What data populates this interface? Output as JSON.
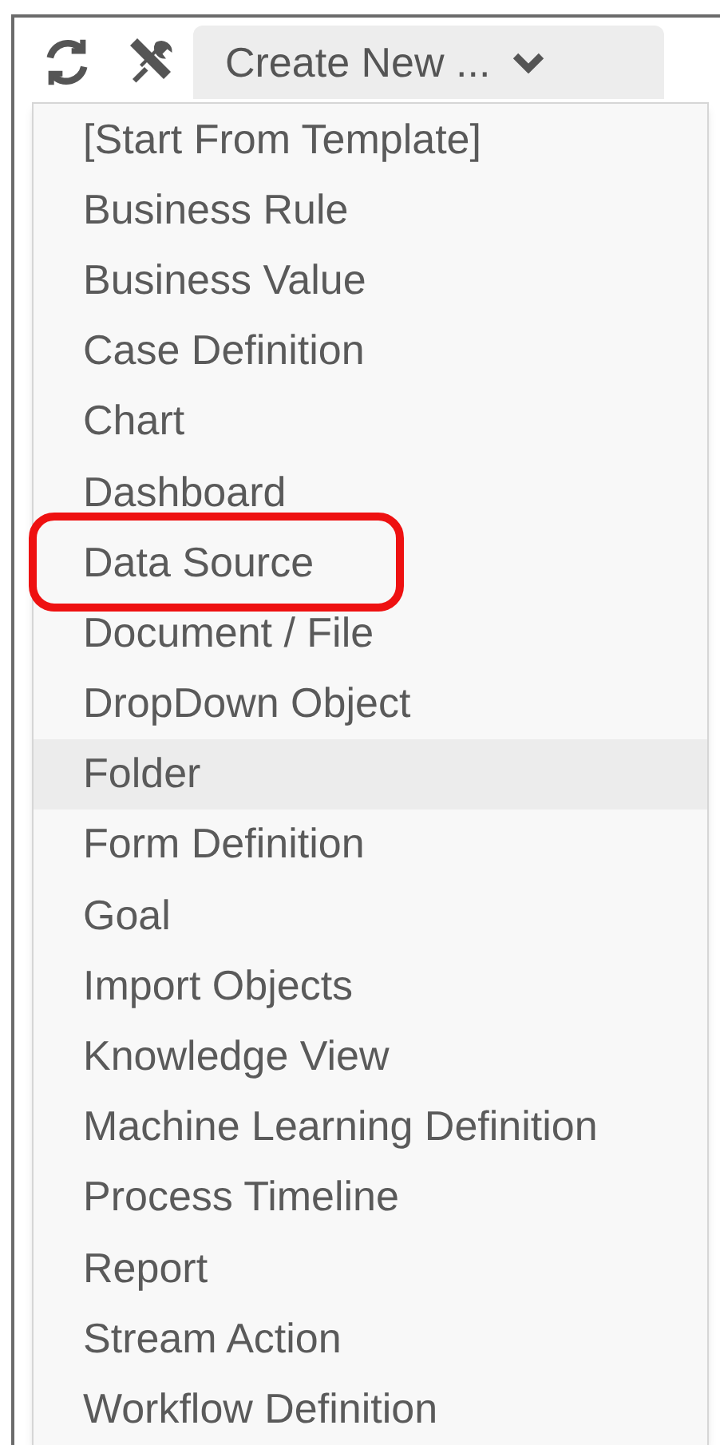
{
  "toolbar": {
    "create_button": {
      "label": "Create New ..."
    }
  },
  "menu": {
    "items": [
      {
        "label": "[Start From Template]",
        "hovered": false,
        "annotated": false
      },
      {
        "label": "Business Rule",
        "hovered": false,
        "annotated": false
      },
      {
        "label": "Business Value",
        "hovered": false,
        "annotated": false
      },
      {
        "label": "Case Definition",
        "hovered": false,
        "annotated": false
      },
      {
        "label": "Chart",
        "hovered": false,
        "annotated": false
      },
      {
        "label": "Dashboard",
        "hovered": false,
        "annotated": false
      },
      {
        "label": "Data Source",
        "hovered": false,
        "annotated": true
      },
      {
        "label": "Document / File",
        "hovered": false,
        "annotated": false
      },
      {
        "label": "DropDown Object",
        "hovered": false,
        "annotated": false
      },
      {
        "label": "Folder",
        "hovered": true,
        "annotated": false
      },
      {
        "label": "Form Definition",
        "hovered": false,
        "annotated": false
      },
      {
        "label": "Goal",
        "hovered": false,
        "annotated": false
      },
      {
        "label": "Import Objects",
        "hovered": false,
        "annotated": false
      },
      {
        "label": "Knowledge View",
        "hovered": false,
        "annotated": false
      },
      {
        "label": "Machine Learning Definition",
        "hovered": false,
        "annotated": false
      },
      {
        "label": "Process Timeline",
        "hovered": false,
        "annotated": false
      },
      {
        "label": "Report",
        "hovered": false,
        "annotated": false
      },
      {
        "label": "Stream Action",
        "hovered": false,
        "annotated": false
      },
      {
        "label": "Workflow Definition",
        "hovered": false,
        "annotated": false
      }
    ]
  }
}
